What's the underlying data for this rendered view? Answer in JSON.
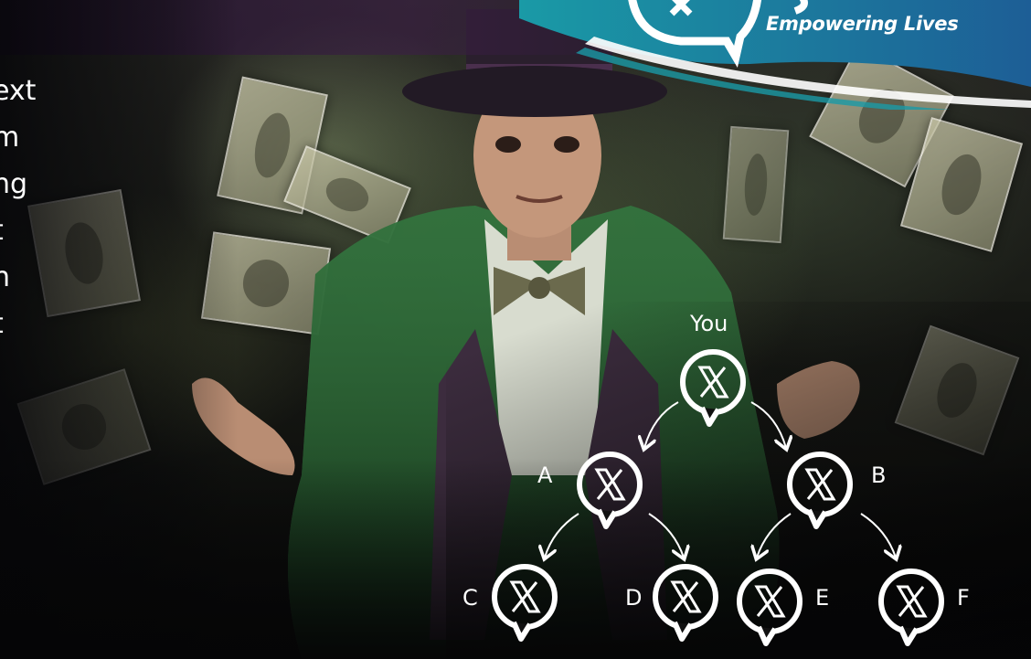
{
  "brand": {
    "tagline": "Empowering Lives"
  },
  "side_text": {
    "lines": [
      "ext",
      "m",
      "ng",
      "t",
      "n",
      "t"
    ]
  },
  "referral_tree": {
    "root_label": "You",
    "nodes": [
      {
        "label": "A",
        "icon": "x-chat-bubble-icon"
      },
      {
        "label": "B",
        "icon": "x-chat-bubble-icon"
      },
      {
        "label": "C",
        "icon": "x-chat-bubble-icon"
      },
      {
        "label": "D",
        "icon": "x-chat-bubble-icon"
      },
      {
        "label": "E",
        "icon": "x-chat-bubble-icon"
      },
      {
        "label": "F",
        "icon": "x-chat-bubble-icon"
      }
    ]
  },
  "colors": {
    "banner_teal": "#1a9aa6",
    "banner_blue": "#1d5e96",
    "diagram_white": "#ffffff",
    "jacket_green": "#2f6b3a"
  }
}
